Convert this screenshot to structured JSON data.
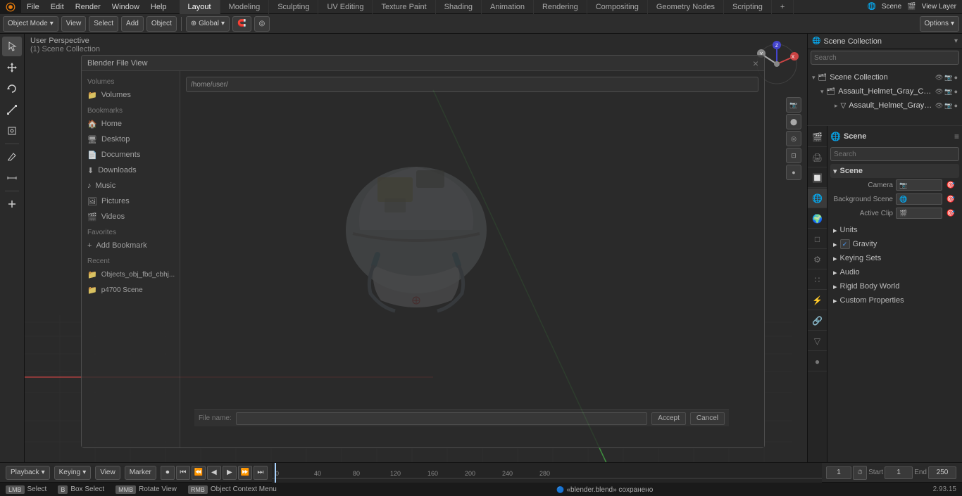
{
  "app": {
    "title": "Blender",
    "version": "2.93.15"
  },
  "top_menu": {
    "items": [
      "File",
      "Edit",
      "Render",
      "Window",
      "Help"
    ],
    "workspace_tabs": [
      "Layout",
      "Modeling",
      "Sculpting",
      "UV Editing",
      "Texture Paint",
      "Shading",
      "Animation",
      "Rendering",
      "Compositing",
      "Geometry Nodes",
      "Scripting"
    ],
    "active_tab": "Layout",
    "scene_label": "Scene",
    "view_layer_label": "View Layer",
    "plus_label": "+"
  },
  "second_toolbar": {
    "mode_label": "Object Mode",
    "view_label": "View",
    "select_label": "Select",
    "add_label": "Add",
    "object_label": "Object",
    "global_label": "Global",
    "snap_label": "Snap",
    "proportional_label": "Proportional",
    "options_label": "Options"
  },
  "viewport": {
    "title": "User Perspective",
    "subtitle": "(1) Scene Collection"
  },
  "left_toolbar": {
    "tools": [
      "cursor",
      "move",
      "rotate",
      "scale",
      "transform",
      "annotate",
      "measure",
      "add",
      "select"
    ]
  },
  "outliner": {
    "title": "Scene Collection",
    "search_placeholder": "Search",
    "items": [
      {
        "label": "Assault_Helmet_Gray_Camo...",
        "icon": "triangle",
        "expanded": true,
        "children": [
          {
            "label": "Assault_Helmet_Gray_Ca...",
            "icon": "mesh"
          }
        ]
      }
    ]
  },
  "properties": {
    "scene_label": "Scene",
    "search_placeholder": "Search",
    "sections": {
      "scene": {
        "title": "Scene",
        "camera_label": "Camera",
        "camera_value": "",
        "background_scene_label": "Background Scene",
        "background_scene_value": "",
        "active_clip_label": "Active Clip",
        "active_clip_value": ""
      },
      "units_label": "Units",
      "gravity_label": "Gravity",
      "gravity_checked": true,
      "keying_sets_label": "Keying Sets",
      "audio_label": "Audio",
      "rigid_body_world_label": "Rigid Body World",
      "custom_properties_label": "Custom Properties"
    },
    "tabs": [
      "render",
      "output",
      "view_layer",
      "scene",
      "world",
      "object",
      "modifier",
      "particles",
      "physics",
      "constraints",
      "data",
      "material",
      "texture",
      "shading"
    ]
  },
  "timeline": {
    "playback_label": "Playback",
    "keying_label": "Keying",
    "view_label": "View",
    "marker_label": "Marker",
    "current_frame": "1",
    "start_frame": "1",
    "end_frame": "250",
    "start_label": "Start",
    "end_label": "End",
    "frame_markers": [
      "0",
      "40",
      "80",
      "120",
      "160",
      "200",
      "240"
    ]
  },
  "status_bar": {
    "select_label": "Select",
    "box_select_label": "Box Select",
    "rotate_view_label": "Rotate View",
    "object_context_label": "Object Context Menu",
    "file_label": "«blender.blend» сохранено",
    "version": "2.93.15"
  },
  "file_view": {
    "title": "Blender File View",
    "sidebar_items": [
      {
        "label": "Volumes",
        "icon": "folder"
      },
      {
        "label": "Bookmarks",
        "icon": "folder"
      },
      {
        "label": "Home",
        "icon": "home"
      },
      {
        "label": "Desktop",
        "icon": "desktop"
      },
      {
        "label": "Documents",
        "icon": "doc"
      },
      {
        "label": "Downloads",
        "icon": "down"
      },
      {
        "label": "Music",
        "icon": "music"
      },
      {
        "label": "Pictures",
        "icon": "pic"
      },
      {
        "label": "Videos",
        "icon": "vid"
      },
      {
        "label": "Favorites",
        "icon": "star"
      },
      {
        "label": "Add Bookmark",
        "icon": "plus"
      },
      {
        "label": "Recent",
        "icon": "clock"
      }
    ]
  },
  "icons": {
    "cursor": "⊕",
    "move": "✥",
    "rotate": "↺",
    "scale": "⤢",
    "transform": "⊞",
    "annotate": "✏",
    "measure": "📏",
    "add": "+",
    "chevron_down": "▾",
    "chevron_right": "▸",
    "eye": "👁",
    "camera": "📷",
    "render": "🎬",
    "scene": "🌐",
    "world": "🌍",
    "object": "□",
    "modifier": "⚙",
    "material": "●",
    "particles": "∷",
    "physics": "⚡",
    "constraints": "🔗",
    "data": "▽",
    "texture": "◈",
    "shading": "☀",
    "check": "✓",
    "folder": "📁",
    "home": "🏠",
    "collection": "🗂"
  },
  "colors": {
    "accent": "#4a9eff",
    "bg_dark": "#1a1a1a",
    "bg_medium": "#2a2a2a",
    "bg_light": "#333333",
    "border": "#111111",
    "text_bright": "#ffffff",
    "text_normal": "#cccccc",
    "text_dim": "#888888",
    "active_tab": "#3a3a3a",
    "axis_x": "#cc3333",
    "axis_y": "#33aa33",
    "axis_z": "#3366cc"
  }
}
